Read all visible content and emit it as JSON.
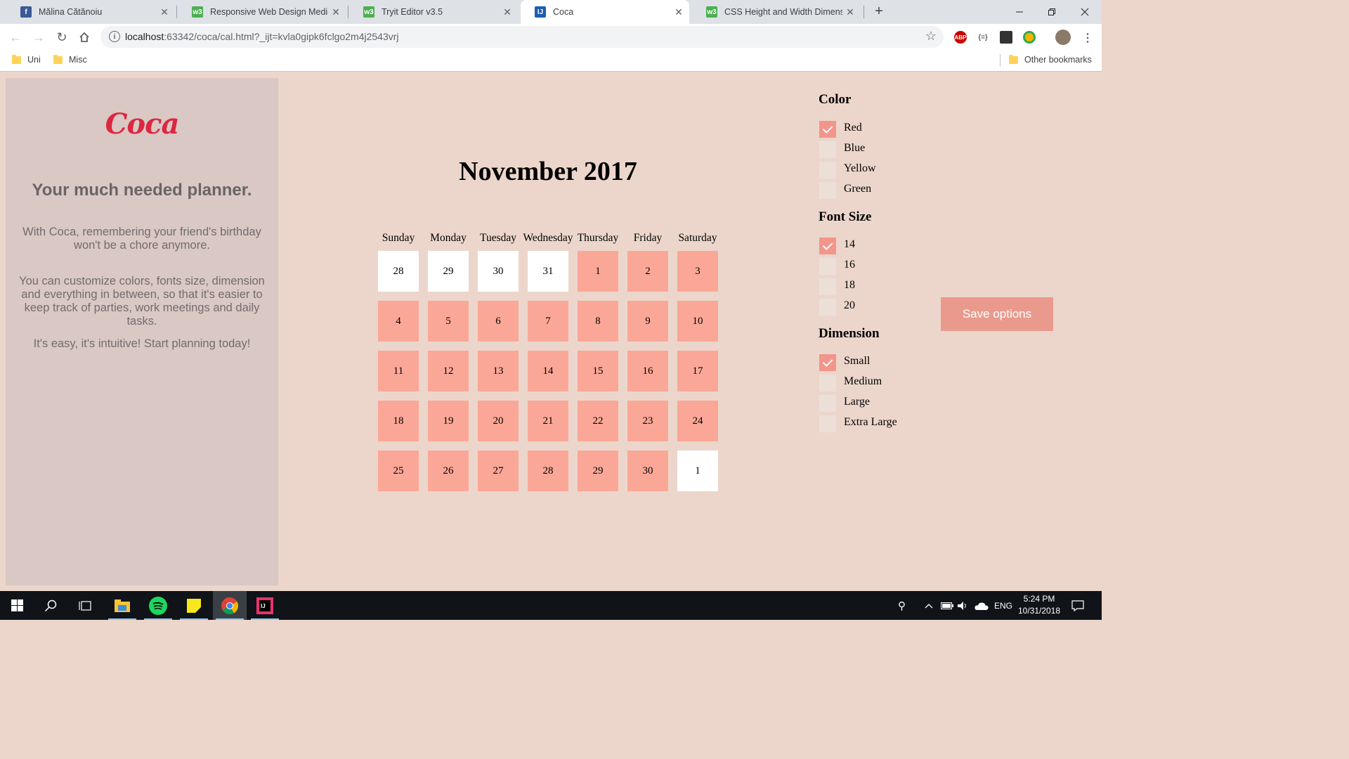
{
  "browser": {
    "tabs": [
      {
        "title": "Mălina Cătănoiu",
        "icon": "facebook-icon",
        "color": "#3b5998",
        "glyph": "f"
      },
      {
        "title": "Responsive Web Design Media Q",
        "icon": "w3schools-icon",
        "color": "#4caf50",
        "glyph": "w3"
      },
      {
        "title": "Tryit Editor v3.5",
        "icon": "w3schools-icon",
        "color": "#4caf50",
        "glyph": "w3"
      },
      {
        "title": "Coca",
        "icon": "intellij-icon",
        "color": "#1a5fb4",
        "glyph": "IJ"
      },
      {
        "title": "CSS Height and Width Dimensio",
        "icon": "w3schools-icon",
        "color": "#4caf50",
        "glyph": "w3"
      }
    ],
    "new_tab_label": "+",
    "url_host": "localhost",
    "url_rest": ":63342/coca/cal.html?_ijt=kvla0gipk6fclgo2m4j2543vrj",
    "bookmarks": [
      "Uni",
      "Misc"
    ],
    "other_bookmarks": "Other bookmarks"
  },
  "sidebar": {
    "logo": "Coca",
    "tagline": "Your much needed planner.",
    "paragraphs": [
      "With Coca, remembering your friend's birthday won't be a chore anymore.",
      "You can customize colors, fonts size, dimension and everything in between, so that it's easier to keep track of parties, work meetings and daily tasks.",
      "It's easy, it's intuitive! Start planning today!"
    ]
  },
  "calendar": {
    "title": "November 2017",
    "weekdays": [
      "Sunday",
      "Monday",
      "Tuesday",
      "Wednesday",
      "Thursday",
      "Friday",
      "Saturday"
    ],
    "weeks": [
      [
        {
          "d": "28",
          "cur": false
        },
        {
          "d": "29",
          "cur": false
        },
        {
          "d": "30",
          "cur": false
        },
        {
          "d": "31",
          "cur": false
        },
        {
          "d": "1",
          "cur": true
        },
        {
          "d": "2",
          "cur": true
        },
        {
          "d": "3",
          "cur": true
        }
      ],
      [
        {
          "d": "4",
          "cur": true
        },
        {
          "d": "5",
          "cur": true
        },
        {
          "d": "6",
          "cur": true
        },
        {
          "d": "7",
          "cur": true
        },
        {
          "d": "8",
          "cur": true
        },
        {
          "d": "9",
          "cur": true
        },
        {
          "d": "10",
          "cur": true
        }
      ],
      [
        {
          "d": "11",
          "cur": true
        },
        {
          "d": "12",
          "cur": true
        },
        {
          "d": "13",
          "cur": true
        },
        {
          "d": "14",
          "cur": true
        },
        {
          "d": "15",
          "cur": true
        },
        {
          "d": "16",
          "cur": true
        },
        {
          "d": "17",
          "cur": true
        }
      ],
      [
        {
          "d": "18",
          "cur": true
        },
        {
          "d": "19",
          "cur": true
        },
        {
          "d": "20",
          "cur": true
        },
        {
          "d": "21",
          "cur": true
        },
        {
          "d": "22",
          "cur": true
        },
        {
          "d": "23",
          "cur": true
        },
        {
          "d": "24",
          "cur": true
        }
      ],
      [
        {
          "d": "25",
          "cur": true
        },
        {
          "d": "26",
          "cur": true
        },
        {
          "d": "27",
          "cur": true
        },
        {
          "d": "28",
          "cur": true
        },
        {
          "d": "29",
          "cur": true
        },
        {
          "d": "30",
          "cur": true
        },
        {
          "d": "1",
          "cur": false
        }
      ]
    ],
    "current_month_color": "#fba797",
    "other_month_color": "#ffffff"
  },
  "options": {
    "groups": [
      {
        "heading": "Color",
        "items": [
          {
            "label": "Red",
            "checked": true
          },
          {
            "label": "Blue",
            "checked": false
          },
          {
            "label": "Yellow",
            "checked": false
          },
          {
            "label": "Green",
            "checked": false
          }
        ]
      },
      {
        "heading": "Font Size",
        "items": [
          {
            "label": "14",
            "checked": true
          },
          {
            "label": "16",
            "checked": false
          },
          {
            "label": "18",
            "checked": false
          },
          {
            "label": "20",
            "checked": false
          }
        ]
      },
      {
        "heading": "Dimension",
        "items": [
          {
            "label": "Small",
            "checked": true
          },
          {
            "label": "Medium",
            "checked": false
          },
          {
            "label": "Large",
            "checked": false
          },
          {
            "label": "Extra Large",
            "checked": false
          }
        ]
      }
    ],
    "save_label": "Save options",
    "accent": "#f2958a"
  },
  "taskbar": {
    "language": "ENG",
    "time": "5:24 PM",
    "date": "10/31/2018"
  }
}
